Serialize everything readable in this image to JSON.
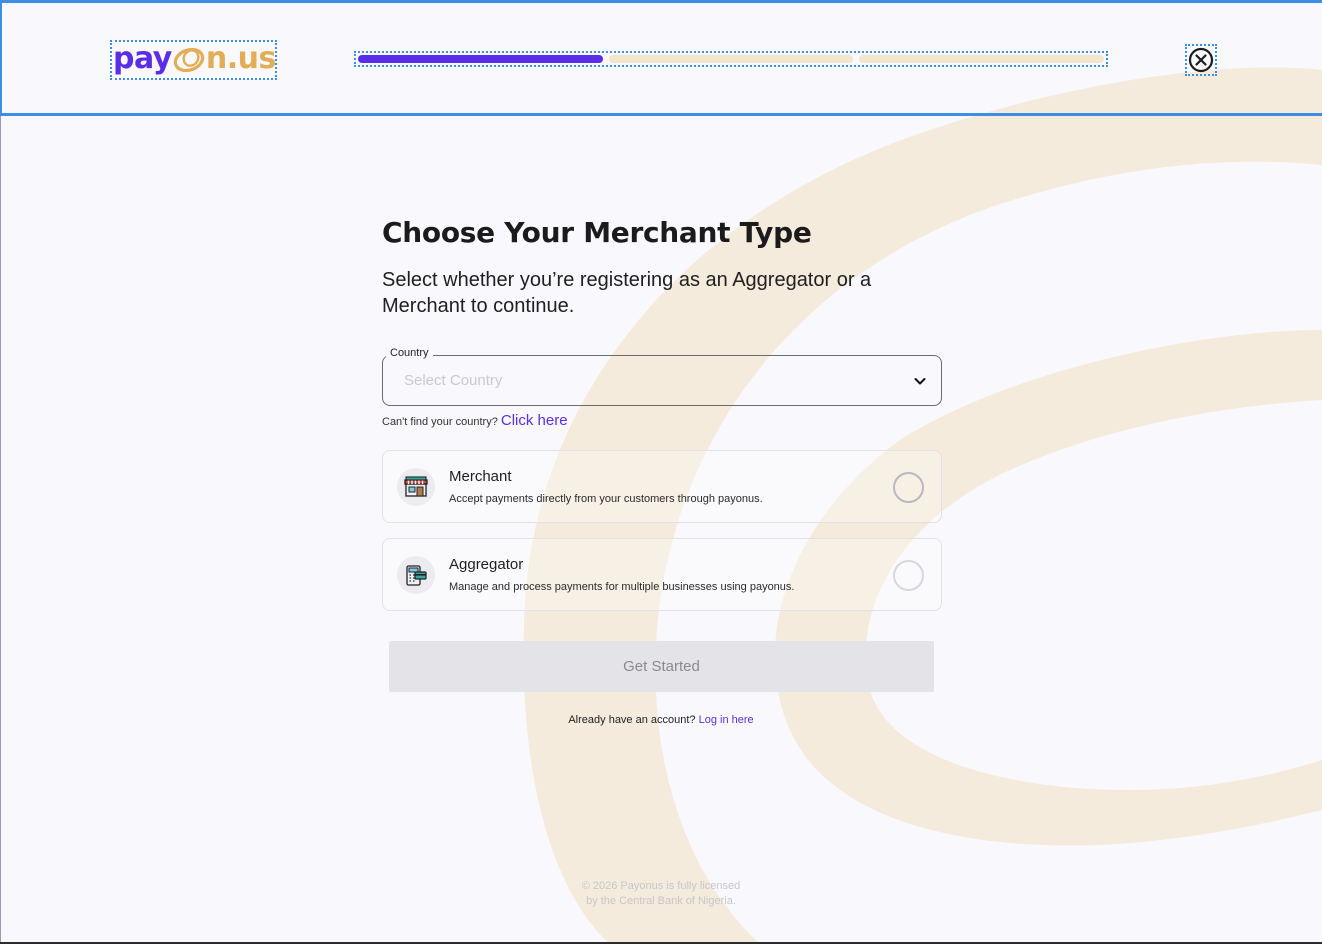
{
  "header": {
    "logo": {
      "part1": "pay",
      "part2": "n.us",
      "icon": "swirl-o-icon"
    },
    "progress": {
      "steps_total": 3,
      "steps_completed": 1
    },
    "close_icon": "close-circle-icon"
  },
  "main": {
    "title": "Choose Your Merchant Type",
    "subtitle": "Select whether you’re registering as an Aggregator or a Merchant to continue.",
    "country": {
      "label": "Country",
      "placeholder": "Select Country",
      "icon": "chevron-down-icon"
    },
    "help": {
      "text": "Can't find your country?",
      "link": "Click here"
    },
    "options": [
      {
        "id": "merchant",
        "title": "Merchant",
        "description": "Accept payments directly from your customers through payonus.",
        "icon": "storefront-icon",
        "selected": false
      },
      {
        "id": "aggregator",
        "title": "Aggregator",
        "description": "Manage and process payments for multiple businesses using payonus.",
        "icon": "pos-terminal-icon",
        "selected": false
      }
    ],
    "cta_label": "Get Started",
    "login": {
      "text": "Already have an account?",
      "link": "Log in here"
    }
  },
  "footer": {
    "line1": "© 2026 Payonus  is fully licensed",
    "line2": "by the Central Bank of Nigeria."
  },
  "colors": {
    "brand_purple": "#5a2ee8",
    "brand_gold": "#e3ad55",
    "swirl": "#f4ebdc",
    "selection_outline": "#3d8ee6"
  }
}
